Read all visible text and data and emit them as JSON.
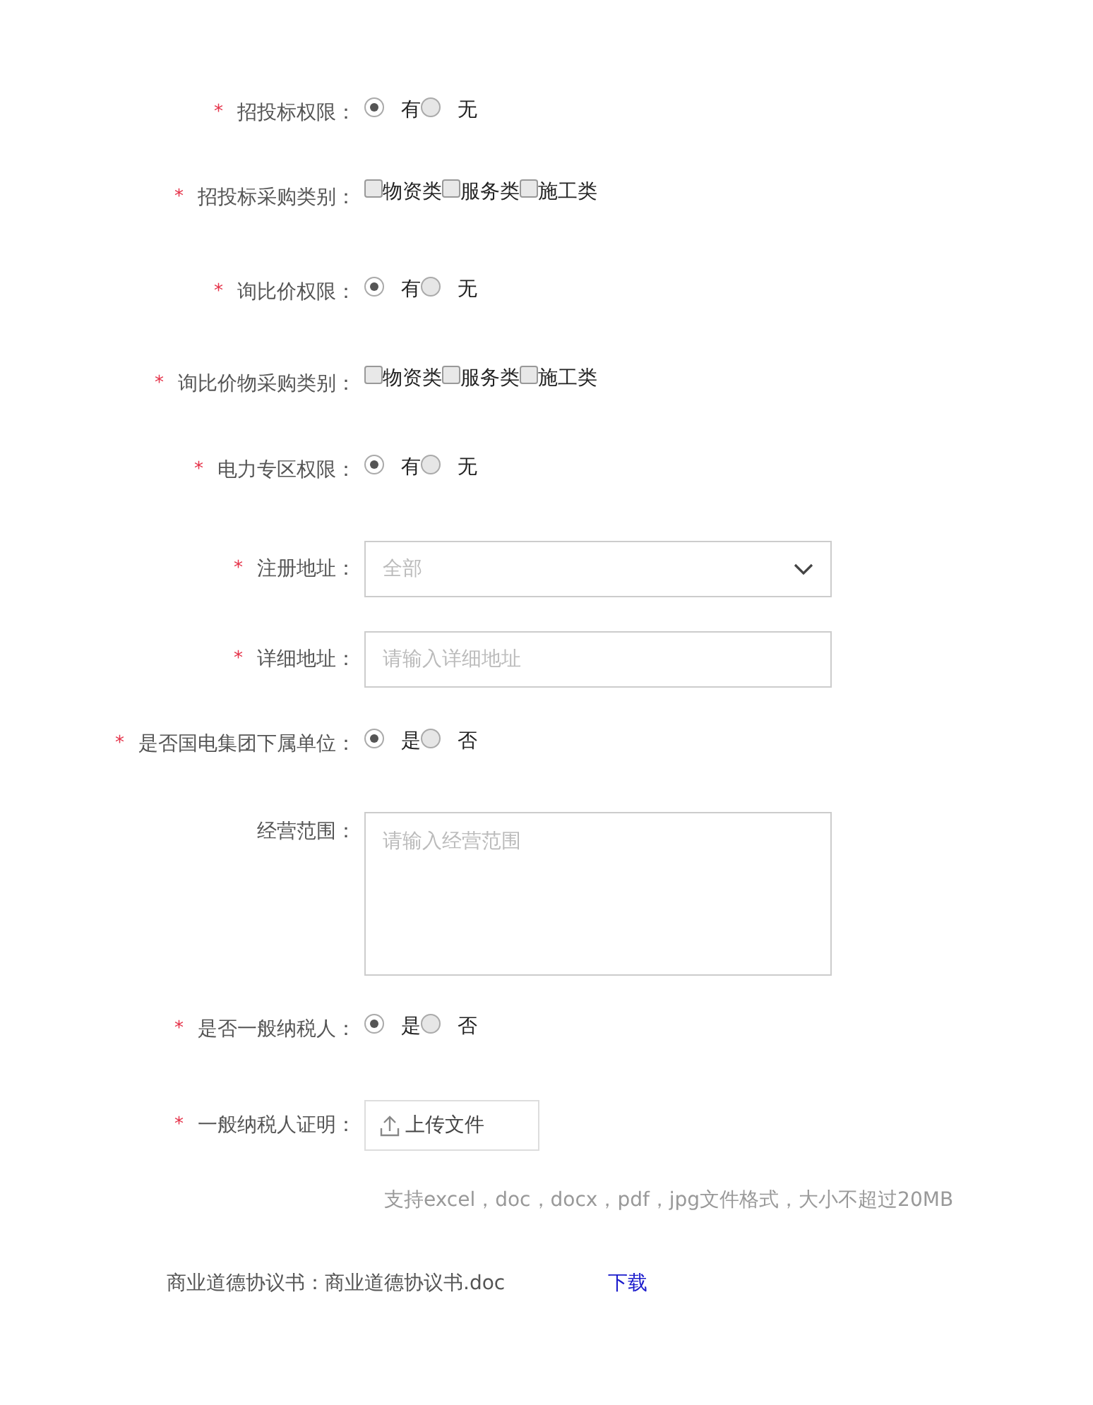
{
  "fields": [
    {
      "kind": "radio",
      "required_mark": "*",
      "label": "招投标权限：",
      "options": [
        {
          "label": "有",
          "selected": true
        },
        {
          "label": "无",
          "selected": false
        }
      ]
    },
    {
      "kind": "checkbox",
      "required_mark": "*",
      "label": "招投标采购类别：",
      "options": [
        {
          "label": "物资类",
          "checked": false
        },
        {
          "label": "服务类",
          "checked": false
        },
        {
          "label": "施工类",
          "checked": false
        }
      ]
    },
    {
      "kind": "radio",
      "required_mark": "*",
      "label": "询比价权限：",
      "options": [
        {
          "label": "有",
          "selected": true
        },
        {
          "label": "无",
          "selected": false
        }
      ]
    },
    {
      "kind": "checkbox",
      "required_mark": "*",
      "label": "询比价物采购类别：",
      "options": [
        {
          "label": "物资类",
          "checked": false
        },
        {
          "label": "服务类",
          "checked": false
        },
        {
          "label": "施工类",
          "checked": false
        }
      ]
    },
    {
      "kind": "radio",
      "required_mark": "*",
      "label": "电力专区权限：",
      "options": [
        {
          "label": "有",
          "selected": true
        },
        {
          "label": "无",
          "selected": false
        }
      ]
    },
    {
      "kind": "select",
      "required_mark": "*",
      "label": "注册地址：",
      "placeholder": "全部"
    },
    {
      "kind": "input",
      "required_mark": "*",
      "label": "详细地址：",
      "placeholder": "请输入详细地址"
    },
    {
      "kind": "radio",
      "required_mark": "*",
      "label": "是否国电集团下属单位：",
      "options": [
        {
          "label": "是",
          "selected": true
        },
        {
          "label": "否",
          "selected": false
        }
      ]
    },
    {
      "kind": "textarea",
      "label": "经营范围：",
      "placeholder": "请输入经营范围"
    },
    {
      "kind": "radio",
      "required_mark": "*",
      "label": "是否一般纳税人：",
      "options": [
        {
          "label": "是",
          "selected": true
        },
        {
          "label": "否",
          "selected": false
        }
      ]
    },
    {
      "kind": "upload",
      "required_mark": "*",
      "label": "一般纳税人证明：",
      "button": "上传文件",
      "hint": "支持excel，doc，docx，pdf，jpg文件格式，大小不超过20MB"
    },
    {
      "kind": "file",
      "label": "商业道德协议书：",
      "value": "商业道德协议书.doc",
      "link": "下载"
    }
  ]
}
